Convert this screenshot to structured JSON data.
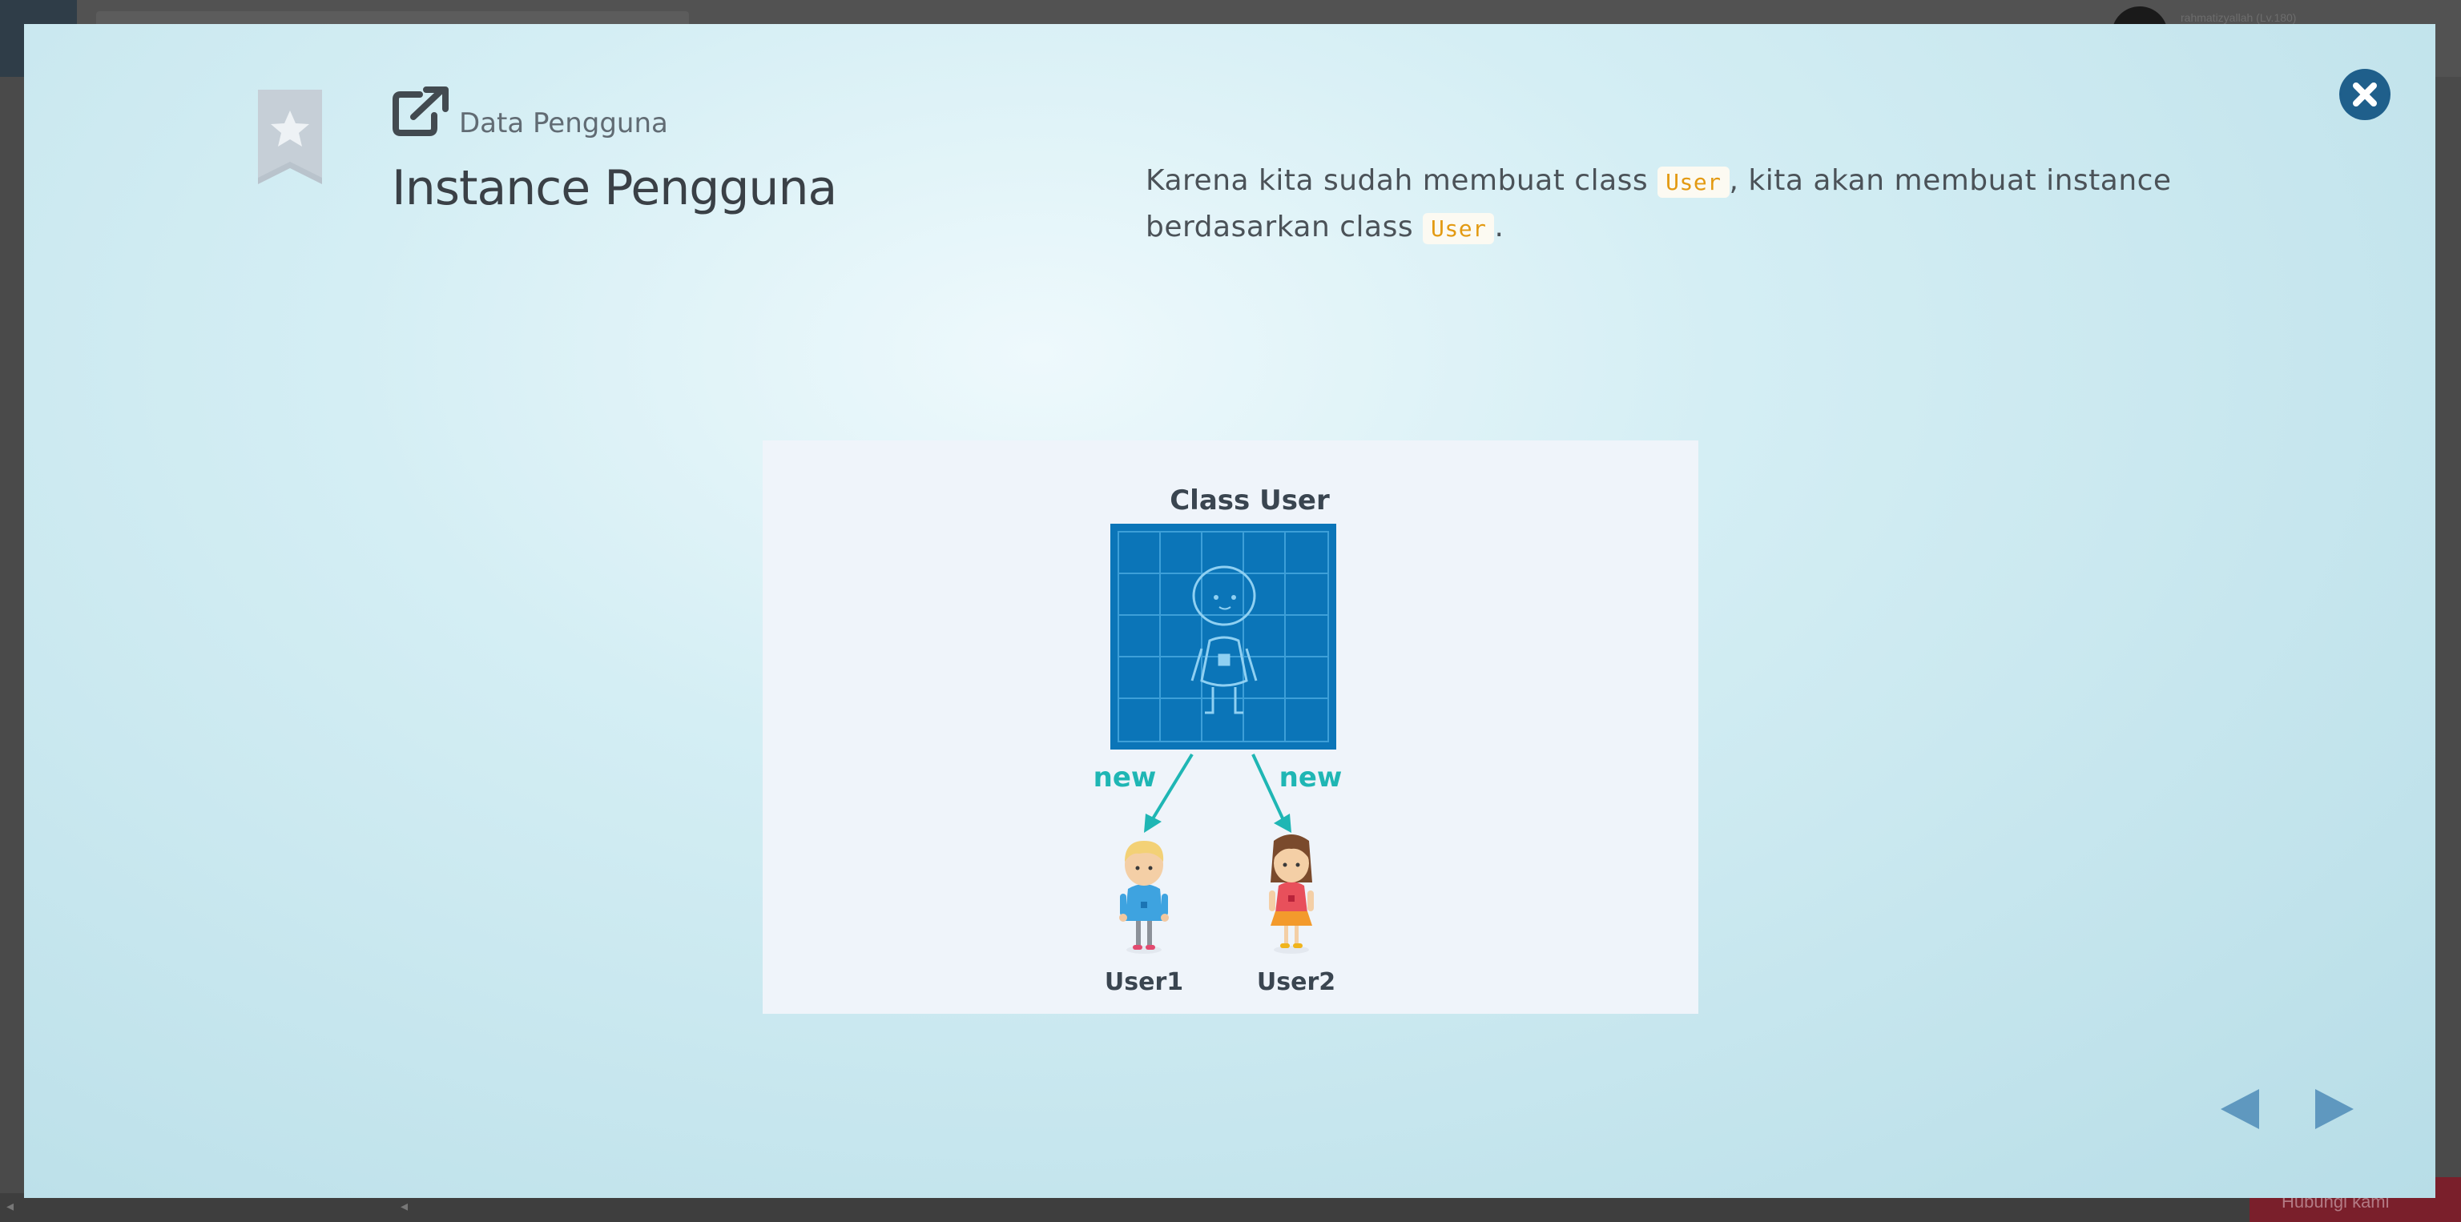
{
  "background": {
    "username": "rahmatizyallah (Lv.180)",
    "bottom_button": "Hubungi kami"
  },
  "modal": {
    "breadcrumb": "Data Pengguna",
    "title": "Instance Pengguna",
    "description": {
      "part1": "Karena kita sudah membuat class ",
      "code1": "User",
      "part2": ", kita akan membuat instance berdasarkan class ",
      "code2": "User",
      "part3": "."
    },
    "icons": {
      "bookmark": "bookmark-star-icon",
      "external": "external-link-icon",
      "close": "close-icon",
      "prev": "triangle-left-icon",
      "next": "triangle-right-icon"
    }
  },
  "diagram": {
    "class_label": "Class User",
    "arrow_left_label": "new",
    "arrow_right_label": "new",
    "instance1_label": "User1",
    "instance2_label": "User2"
  },
  "colors": {
    "accent_blue": "#0b75b8",
    "arrow_teal": "#1fb6b4",
    "close_button": "#1f5f8b",
    "code_text": "#e39a12"
  }
}
